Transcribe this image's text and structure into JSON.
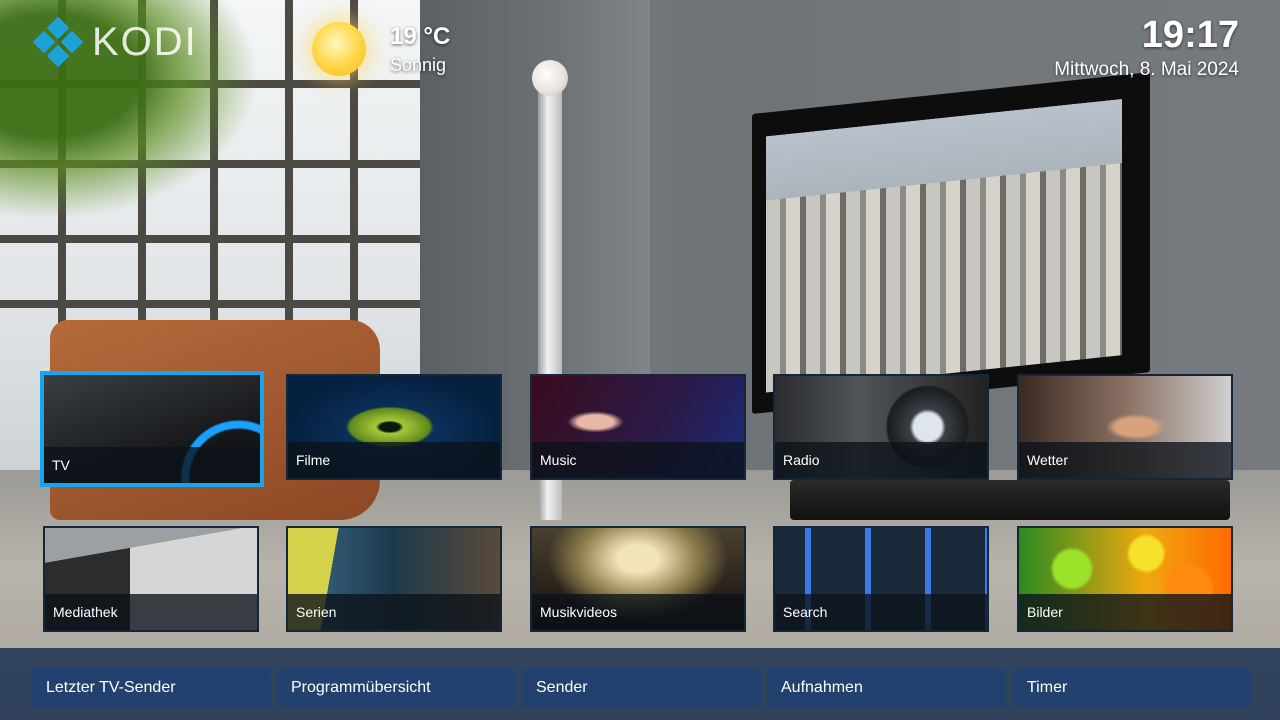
{
  "header": {
    "logo_text": "KODI",
    "weather": {
      "temperature": "19 °C",
      "condition": "Sonnig",
      "icon": "sun-icon"
    },
    "clock": {
      "time": "19:17",
      "date": "Mittwoch, 8. Mai 2024"
    }
  },
  "tiles_row1": [
    {
      "label": "TV",
      "focused": true
    },
    {
      "label": "Filme"
    },
    {
      "label": "Music"
    },
    {
      "label": "Radio"
    },
    {
      "label": "Wetter"
    }
  ],
  "tiles_row2": [
    {
      "label": "Mediathek"
    },
    {
      "label": "Serien"
    },
    {
      "label": "Musikvideos"
    },
    {
      "label": "Search"
    },
    {
      "label": "Bilder"
    }
  ],
  "submenu": [
    {
      "label": "Letzter TV-Sender"
    },
    {
      "label": "Programmübersicht"
    },
    {
      "label": "Sender"
    },
    {
      "label": "Aufnahmen"
    },
    {
      "label": "Timer"
    }
  ],
  "colors": {
    "focus": "#18a4ee",
    "submenu_bg": "#162c4e",
    "logo_blue": "#1ea0d8"
  }
}
